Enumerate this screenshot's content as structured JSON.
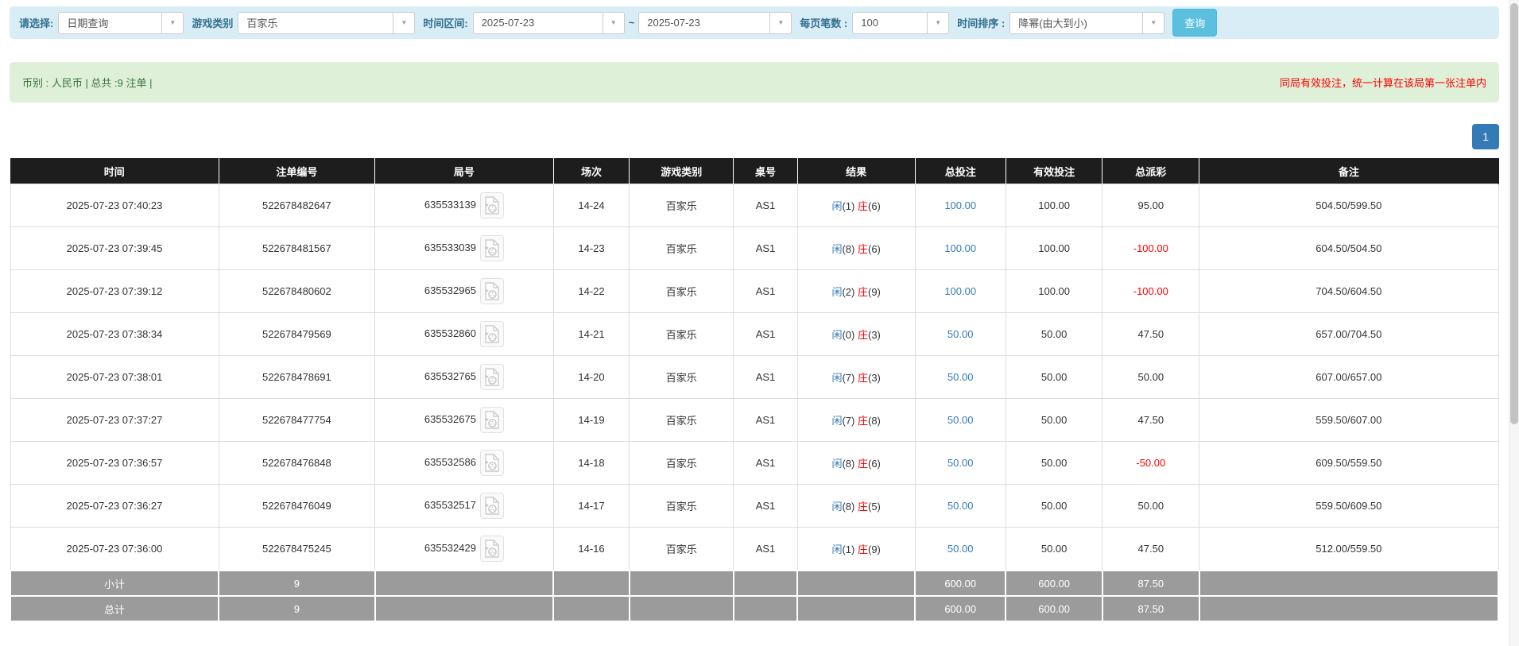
{
  "filter_bar": {
    "select_label": "请选择:",
    "query_type_value": "日期查询",
    "game_category_label": "游戏类别",
    "game_category_value": "百家乐",
    "time_range_label": "时间区间:",
    "date_from_value": "2025-07-23",
    "range_separator": "~",
    "date_to_value": "2025-07-23",
    "page_size_label": "每页笔数 :",
    "page_size_value": "100",
    "time_sort_label": "时间排序 :",
    "time_sort_value": "降幂(由大到小)",
    "search_button_label": "查询"
  },
  "summary_bar": {
    "currency_total_text": "币别 : 人民币 | 总共 :9 注单 |",
    "note_text": "同局有效投注，统一计算在该局第一张注单内"
  },
  "pagination": {
    "current_page": "1"
  },
  "table": {
    "headers": [
      "时间",
      "注单编号",
      "局号",
      "场次",
      "游戏类别",
      "桌号",
      "结果",
      "总投注",
      "有效投注",
      "总派彩",
      "备注"
    ],
    "rows": [
      {
        "time": "2025-07-23 07:40:23",
        "bet_id": "522678482647",
        "round_id": "635533139",
        "session": "14-24",
        "game": "百家乐",
        "table_no": "AS1",
        "result": {
          "player": "闲",
          "player_score": "(1)",
          "banker": "庄",
          "banker_score": "(6)"
        },
        "total_bet": "100.00",
        "valid_bet": "100.00",
        "payout": "95.00",
        "note": "504.50/599.50"
      },
      {
        "time": "2025-07-23 07:39:45",
        "bet_id": "522678481567",
        "round_id": "635533039",
        "session": "14-23",
        "game": "百家乐",
        "table_no": "AS1",
        "result": {
          "player": "闲",
          "player_score": "(8)",
          "banker": "庄",
          "banker_score": "(6)"
        },
        "total_bet": "100.00",
        "valid_bet": "100.00",
        "payout": "-100.00",
        "note": "604.50/504.50"
      },
      {
        "time": "2025-07-23 07:39:12",
        "bet_id": "522678480602",
        "round_id": "635532965",
        "session": "14-22",
        "game": "百家乐",
        "table_no": "AS1",
        "result": {
          "player": "闲",
          "player_score": "(2)",
          "banker": "庄",
          "banker_score": "(9)"
        },
        "total_bet": "100.00",
        "valid_bet": "100.00",
        "payout": "-100.00",
        "note": "704.50/604.50"
      },
      {
        "time": "2025-07-23 07:38:34",
        "bet_id": "522678479569",
        "round_id": "635532860",
        "session": "14-21",
        "game": "百家乐",
        "table_no": "AS1",
        "result": {
          "player": "闲",
          "player_score": "(0)",
          "banker": "庄",
          "banker_score": "(3)"
        },
        "total_bet": "50.00",
        "valid_bet": "50.00",
        "payout": "47.50",
        "note": "657.00/704.50"
      },
      {
        "time": "2025-07-23 07:38:01",
        "bet_id": "522678478691",
        "round_id": "635532765",
        "session": "14-20",
        "game": "百家乐",
        "table_no": "AS1",
        "result": {
          "player": "闲",
          "player_score": "(7)",
          "banker": "庄",
          "banker_score": "(3)"
        },
        "total_bet": "50.00",
        "valid_bet": "50.00",
        "payout": "50.00",
        "note": "607.00/657.00"
      },
      {
        "time": "2025-07-23 07:37:27",
        "bet_id": "522678477754",
        "round_id": "635532675",
        "session": "14-19",
        "game": "百家乐",
        "table_no": "AS1",
        "result": {
          "player": "闲",
          "player_score": "(7)",
          "banker": "庄",
          "banker_score": "(8)"
        },
        "total_bet": "50.00",
        "valid_bet": "50.00",
        "payout": "47.50",
        "note": "559.50/607.00"
      },
      {
        "time": "2025-07-23 07:36:57",
        "bet_id": "522678476848",
        "round_id": "635532586",
        "session": "14-18",
        "game": "百家乐",
        "table_no": "AS1",
        "result": {
          "player": "闲",
          "player_score": "(8)",
          "banker": "庄",
          "banker_score": "(6)"
        },
        "total_bet": "50.00",
        "valid_bet": "50.00",
        "payout": "-50.00",
        "note": "609.50/559.50"
      },
      {
        "time": "2025-07-23 07:36:27",
        "bet_id": "522678476049",
        "round_id": "635532517",
        "session": "14-17",
        "game": "百家乐",
        "table_no": "AS1",
        "result": {
          "player": "闲",
          "player_score": "(8)",
          "banker": "庄",
          "banker_score": "(5)"
        },
        "total_bet": "50.00",
        "valid_bet": "50.00",
        "payout": "50.00",
        "note": "559.50/609.50"
      },
      {
        "time": "2025-07-23 07:36:00",
        "bet_id": "522678475245",
        "round_id": "635532429",
        "session": "14-16",
        "game": "百家乐",
        "table_no": "AS1",
        "result": {
          "player": "闲",
          "player_score": "(1)",
          "banker": "庄",
          "banker_score": "(9)"
        },
        "total_bet": "50.00",
        "valid_bet": "50.00",
        "payout": "47.50",
        "note": "512.00/559.50"
      }
    ],
    "subtotal": {
      "label": "小计",
      "count": "9",
      "total_bet": "600.00",
      "valid_bet": "600.00",
      "payout": "87.50"
    },
    "total": {
      "label": "总计",
      "count": "9",
      "total_bet": "600.00",
      "valid_bet": "600.00",
      "payout": "87.50"
    }
  }
}
